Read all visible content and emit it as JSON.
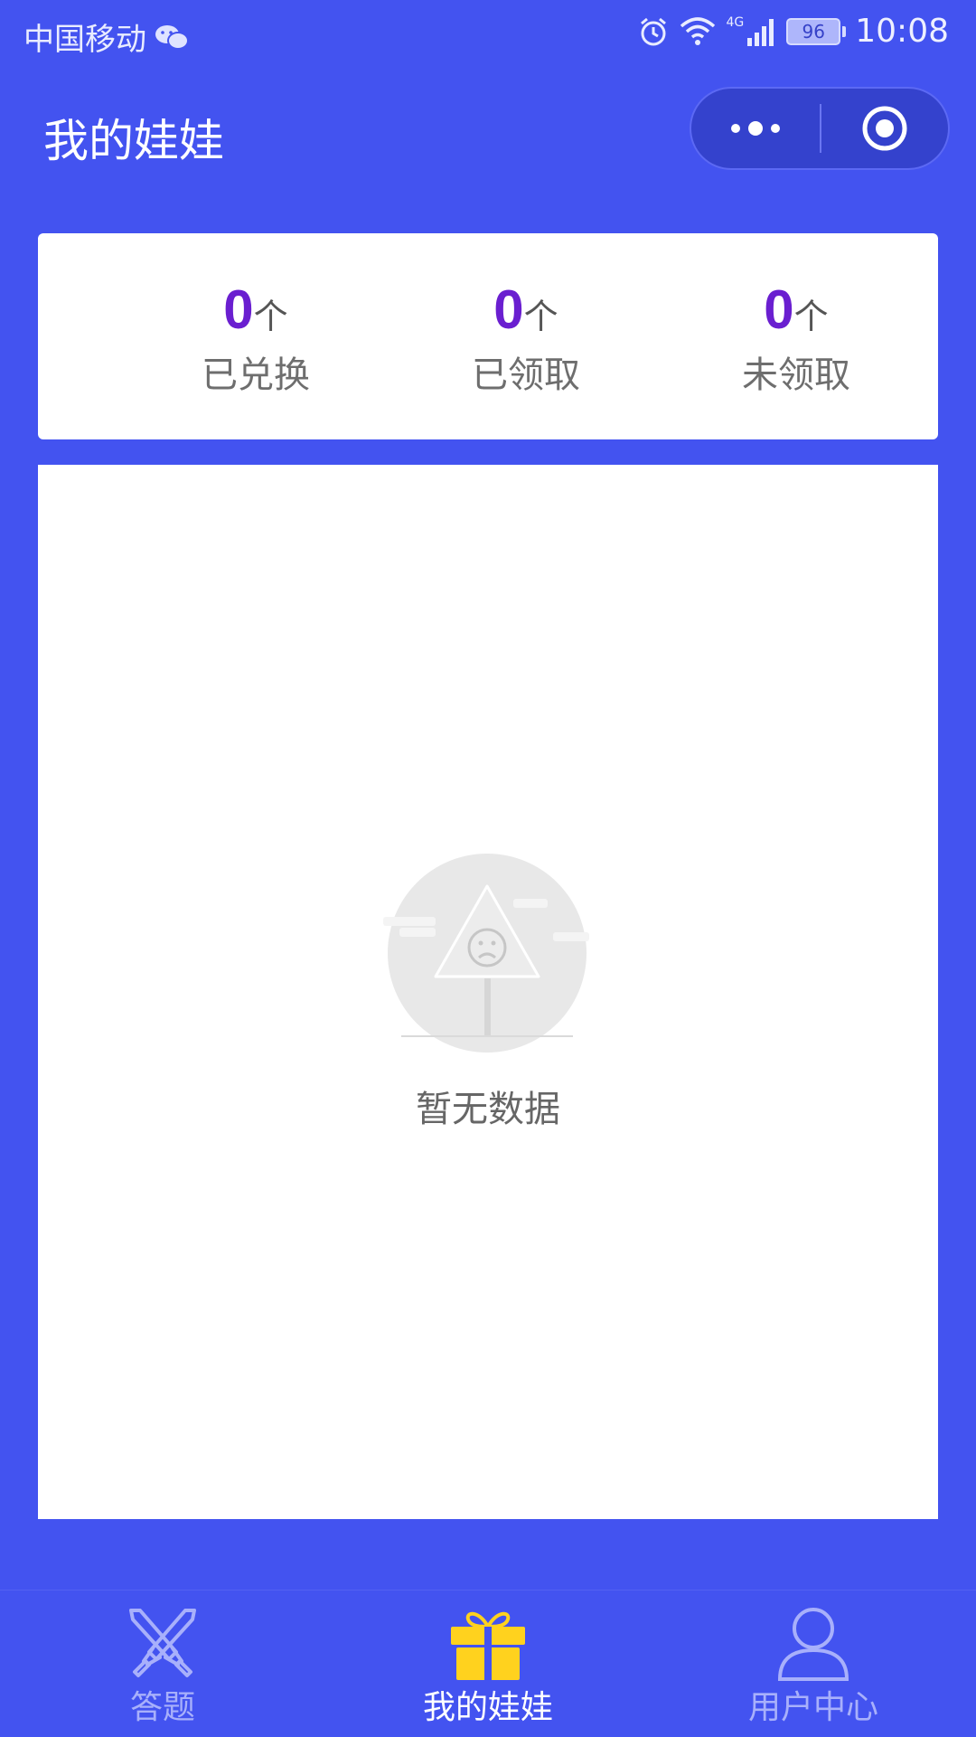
{
  "status_bar": {
    "carrier": "中国移动",
    "network": "4G",
    "battery": "96",
    "time": "10:08"
  },
  "nav": {
    "title": "我的娃娃"
  },
  "stats": [
    {
      "value": "0",
      "unit": "个",
      "label": "已兑换"
    },
    {
      "value": "0",
      "unit": "个",
      "label": "已领取"
    },
    {
      "value": "0",
      "unit": "个",
      "label": "未领取"
    }
  ],
  "empty_state": {
    "text": "暂无数据"
  },
  "tab_bar": {
    "tabs": [
      {
        "label": "答题",
        "icon": "crossed-swords-icon",
        "active": false
      },
      {
        "label": "我的娃娃",
        "icon": "gift-icon",
        "active": true
      },
      {
        "label": "用户中心",
        "icon": "user-icon",
        "active": false
      }
    ]
  },
  "colors": {
    "background": "#4353f0",
    "stat_number": "#6a1fd0",
    "active_icon": "#ffd21e"
  }
}
